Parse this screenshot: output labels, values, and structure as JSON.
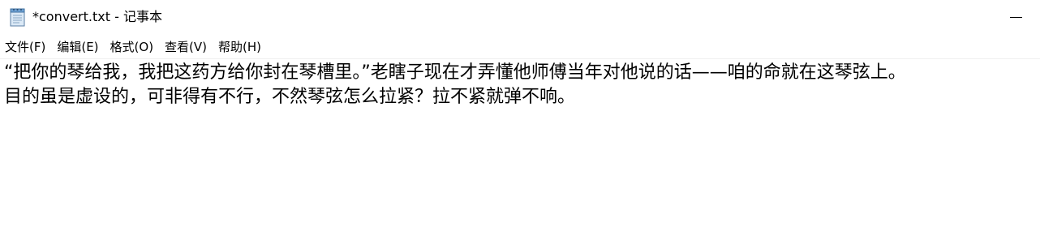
{
  "window": {
    "title": "*convert.txt - 记事本",
    "icon": "notepad-icon"
  },
  "menu": {
    "items": [
      {
        "label": "文件(F)"
      },
      {
        "label": "编辑(E)"
      },
      {
        "label": "格式(O)"
      },
      {
        "label": "查看(V)"
      },
      {
        "label": "帮助(H)"
      }
    ]
  },
  "editor": {
    "lines": [
      "“把你的琴给我，我把这药方给你封在琴槽里。”老瞎子现在才弄懂他师傅当年对他说的话——咱的命就在这琴弦上。",
      "目的虽是虚设的，可非得有不行，不然琴弦怎么拉紧？拉不紧就弹不响。"
    ]
  }
}
